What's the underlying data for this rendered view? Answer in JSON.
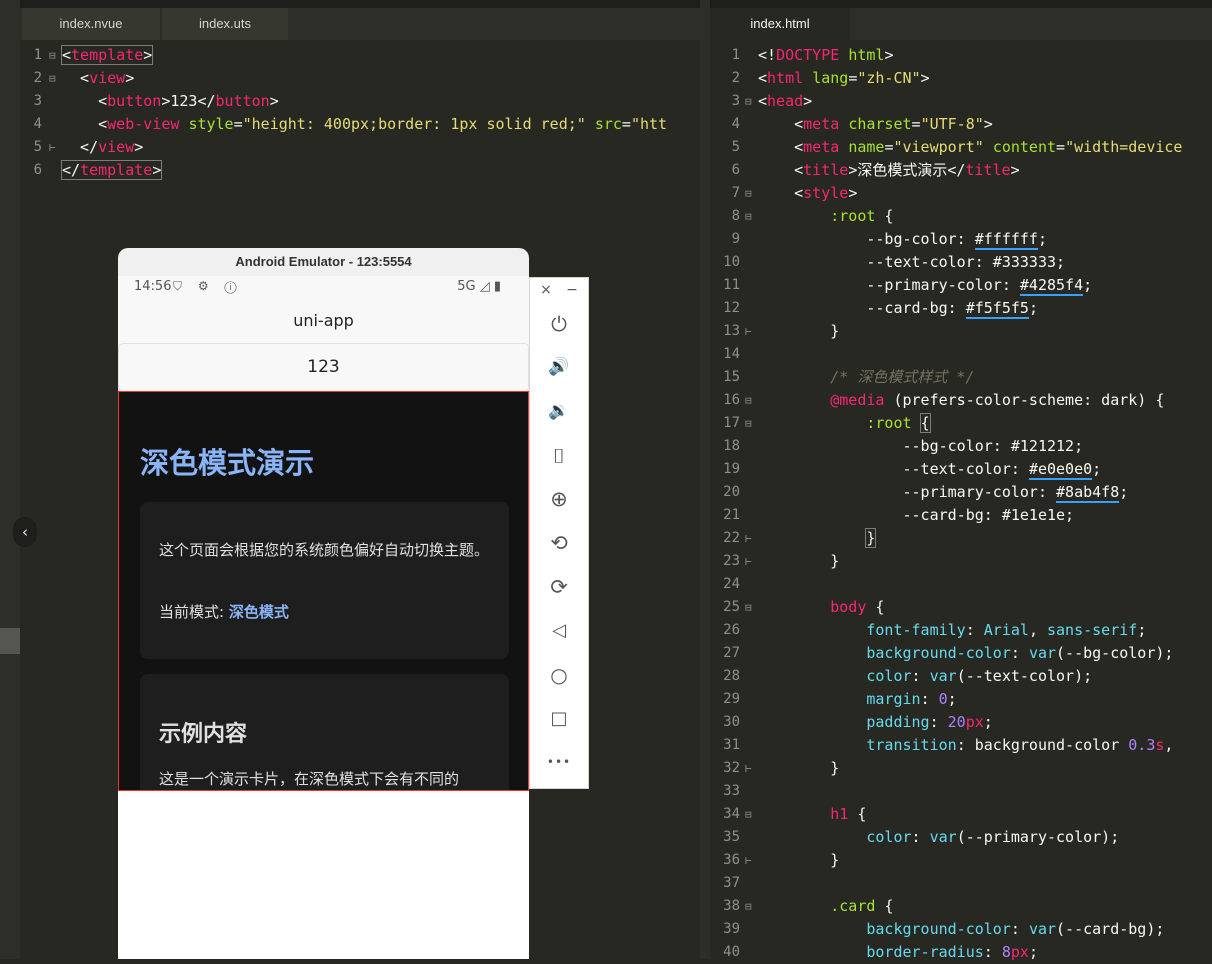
{
  "left_tabs": [
    {
      "label": "index.nvue"
    },
    {
      "label": "index.uts"
    }
  ],
  "right_tabs": [
    {
      "label": "index.html"
    }
  ],
  "left_code": [
    {
      "n": "1",
      "fold": "⊟",
      "html": "<span class=\"hl\">&lt;<span class=\"t\">template</span>&gt;</span>"
    },
    {
      "n": "2",
      "fold": "⊟",
      "html": "  &lt;<span class=\"t\">view</span>&gt;"
    },
    {
      "n": "3",
      "fold": "",
      "html": "    &lt;<span class=\"t\">button</span>&gt;123&lt;/<span class=\"t\">button</span>&gt;"
    },
    {
      "n": "4",
      "fold": "",
      "html": "    &lt;<span class=\"t\">web-view</span> <span class=\"a\">style</span>=<span class=\"s\">\"height: 400px;border: 1px solid red;\"</span> <span class=\"a\">src</span>=<span class=\"s\">\"htt</span>"
    },
    {
      "n": "5",
      "fold": "⊢",
      "html": "  &lt;/<span class=\"t\">view</span>&gt;"
    },
    {
      "n": "6",
      "fold": "",
      "html": "<span class=\"hl\">&lt;/<span class=\"t\">template</span>&gt;</span>"
    }
  ],
  "right_code": [
    {
      "n": "1",
      "fold": "",
      "html": "&lt;!<span class=\"t\">DOCTYPE</span> <span class=\"a\">html</span>&gt;"
    },
    {
      "n": "2",
      "fold": "",
      "html": "&lt;<span class=\"t\">html</span> <span class=\"a\">lang</span>=<span class=\"s\">\"zh-CN\"</span>&gt;"
    },
    {
      "n": "3",
      "fold": "⊟",
      "html": "&lt;<span class=\"t\">head</span>&gt;"
    },
    {
      "n": "4",
      "fold": "",
      "html": "    &lt;<span class=\"t\">meta</span> <span class=\"a\">charset</span>=<span class=\"s\">\"UTF-8\"</span>&gt;"
    },
    {
      "n": "5",
      "fold": "",
      "html": "    &lt;<span class=\"t\">meta</span> <span class=\"a\">name</span>=<span class=\"s\">\"viewport\"</span> <span class=\"a\">content</span>=<span class=\"s\">\"width=device</span>"
    },
    {
      "n": "6",
      "fold": "",
      "html": "    &lt;<span class=\"t\">title</span>&gt;深色模式演示&lt;/<span class=\"t\">title</span>&gt;"
    },
    {
      "n": "7",
      "fold": "⊟",
      "html": "    &lt;<span class=\"t\">style</span>&gt;"
    },
    {
      "n": "8",
      "fold": "⊟",
      "html": "        <span class=\"a\">:root</span> {"
    },
    {
      "n": "9",
      "fold": "",
      "html": "            --bg-color: <span class=\"u\">#ffffff</span>;"
    },
    {
      "n": "10",
      "fold": "",
      "html": "            --text-color: #333333;"
    },
    {
      "n": "11",
      "fold": "",
      "html": "            --primary-color: <span class=\"u\">#4285f4</span>;"
    },
    {
      "n": "12",
      "fold": "",
      "html": "            --card-bg: <span class=\"u\">#f5f5f5</span>;"
    },
    {
      "n": "13",
      "fold": "⊢",
      "html": "        }"
    },
    {
      "n": "14",
      "fold": "",
      "html": ""
    },
    {
      "n": "15",
      "fold": "",
      "html": "        <span class=\"c\">/* 深色模式样式 */</span>"
    },
    {
      "n": "16",
      "fold": "⊟",
      "html": "        <span class=\"t\">@media</span> (prefers-color-scheme: dark) {"
    },
    {
      "n": "17",
      "fold": "⊟",
      "html": "            <span class=\"a\">:root</span> <span class=\"hl\">{</span>"
    },
    {
      "n": "18",
      "fold": "",
      "html": "                --bg-color: #121212;"
    },
    {
      "n": "19",
      "fold": "",
      "html": "                --text-color: <span class=\"u\">#e0e0e0</span>;"
    },
    {
      "n": "20",
      "fold": "",
      "html": "                --primary-color: <span class=\"u\">#8ab4f8</span>;"
    },
    {
      "n": "21",
      "fold": "",
      "html": "                --card-bg: #1e1e1e;"
    },
    {
      "n": "22",
      "fold": "⊢",
      "html": "            <span class=\"hl\">}</span>"
    },
    {
      "n": "23",
      "fold": "⊢",
      "html": "        }"
    },
    {
      "n": "24",
      "fold": "",
      "html": ""
    },
    {
      "n": "25",
      "fold": "⊟",
      "html": "        <span class=\"t\">body</span> {"
    },
    {
      "n": "26",
      "fold": "",
      "html": "            <span class=\"p\">font-family</span>: <span class=\"p\">Arial</span>, <span class=\"p\">sans-serif</span>;"
    },
    {
      "n": "27",
      "fold": "",
      "html": "            <span class=\"p\">background-color</span>: <span class=\"p\">var</span>(--bg-color);"
    },
    {
      "n": "28",
      "fold": "",
      "html": "            <span class=\"p\">color</span>: <span class=\"p\">var</span>(--text-color);"
    },
    {
      "n": "29",
      "fold": "",
      "html": "            <span class=\"p\">margin</span>: <span class=\"n\">0</span>;"
    },
    {
      "n": "30",
      "fold": "",
      "html": "            <span class=\"p\">padding</span>: <span class=\"n\">20</span><span class=\"t\">px</span>;"
    },
    {
      "n": "31",
      "fold": "",
      "html": "            <span class=\"p\">transition</span>: background-color <span class=\"n\">0.3</span><span class=\"t\">s</span>,"
    },
    {
      "n": "32",
      "fold": "⊢",
      "html": "        }"
    },
    {
      "n": "33",
      "fold": "",
      "html": ""
    },
    {
      "n": "34",
      "fold": "⊟",
      "html": "        <span class=\"t\">h1</span> {"
    },
    {
      "n": "35",
      "fold": "",
      "html": "            <span class=\"p\">color</span>: <span class=\"p\">var</span>(--primary-color);"
    },
    {
      "n": "36",
      "fold": "⊢",
      "html": "        }"
    },
    {
      "n": "37",
      "fold": "",
      "html": ""
    },
    {
      "n": "38",
      "fold": "⊟",
      "html": "        <span class=\"a\">.card</span> {"
    },
    {
      "n": "39",
      "fold": "",
      "html": "            <span class=\"p\">background-color</span>: <span class=\"p\">var</span>(--card-bg);"
    },
    {
      "n": "40",
      "fold": "",
      "html": "            <span class=\"p\">border-radius</span>: <span class=\"n\">8</span><span class=\"t\">px</span>;"
    }
  ],
  "emulator": {
    "title": "Android Emulator - 123:5554",
    "status_time": "14:56",
    "status_icons": "⛉ ⚙ ⓘ",
    "status_right": "5G ◿ ▮",
    "nav_title": "uni-app",
    "button_label": "123",
    "webview": {
      "h1": "深色模式演示",
      "card1_text": "这个页面会根据您的系统颜色偏好自动切换主题。",
      "mode_label": "当前模式: ",
      "mode_value": "深色模式",
      "card2_title": "示例内容",
      "card2_text": "这是一个演示卡片，在深色模式下会有不同的"
    },
    "toolbar": {
      "close": "×",
      "minimize": "−",
      "power_icon": "⏻",
      "volume_up_icon": "🔊",
      "volume_down_icon": "🔉",
      "camera_icon": "⌷",
      "zoom_icon": "⊕",
      "rotate_left_icon": "⟲",
      "rotate_right_icon": "⟳",
      "back_icon": "◁",
      "home_icon": "○",
      "overview_icon": "□",
      "more_icon": "•••"
    }
  },
  "colors": {
    "editor_bg": "#272822",
    "tag": "#f92672",
    "attr": "#a6e22e",
    "string": "#e6db74",
    "webview_bg": "#121212",
    "primary_dark": "#8ab4f8"
  }
}
